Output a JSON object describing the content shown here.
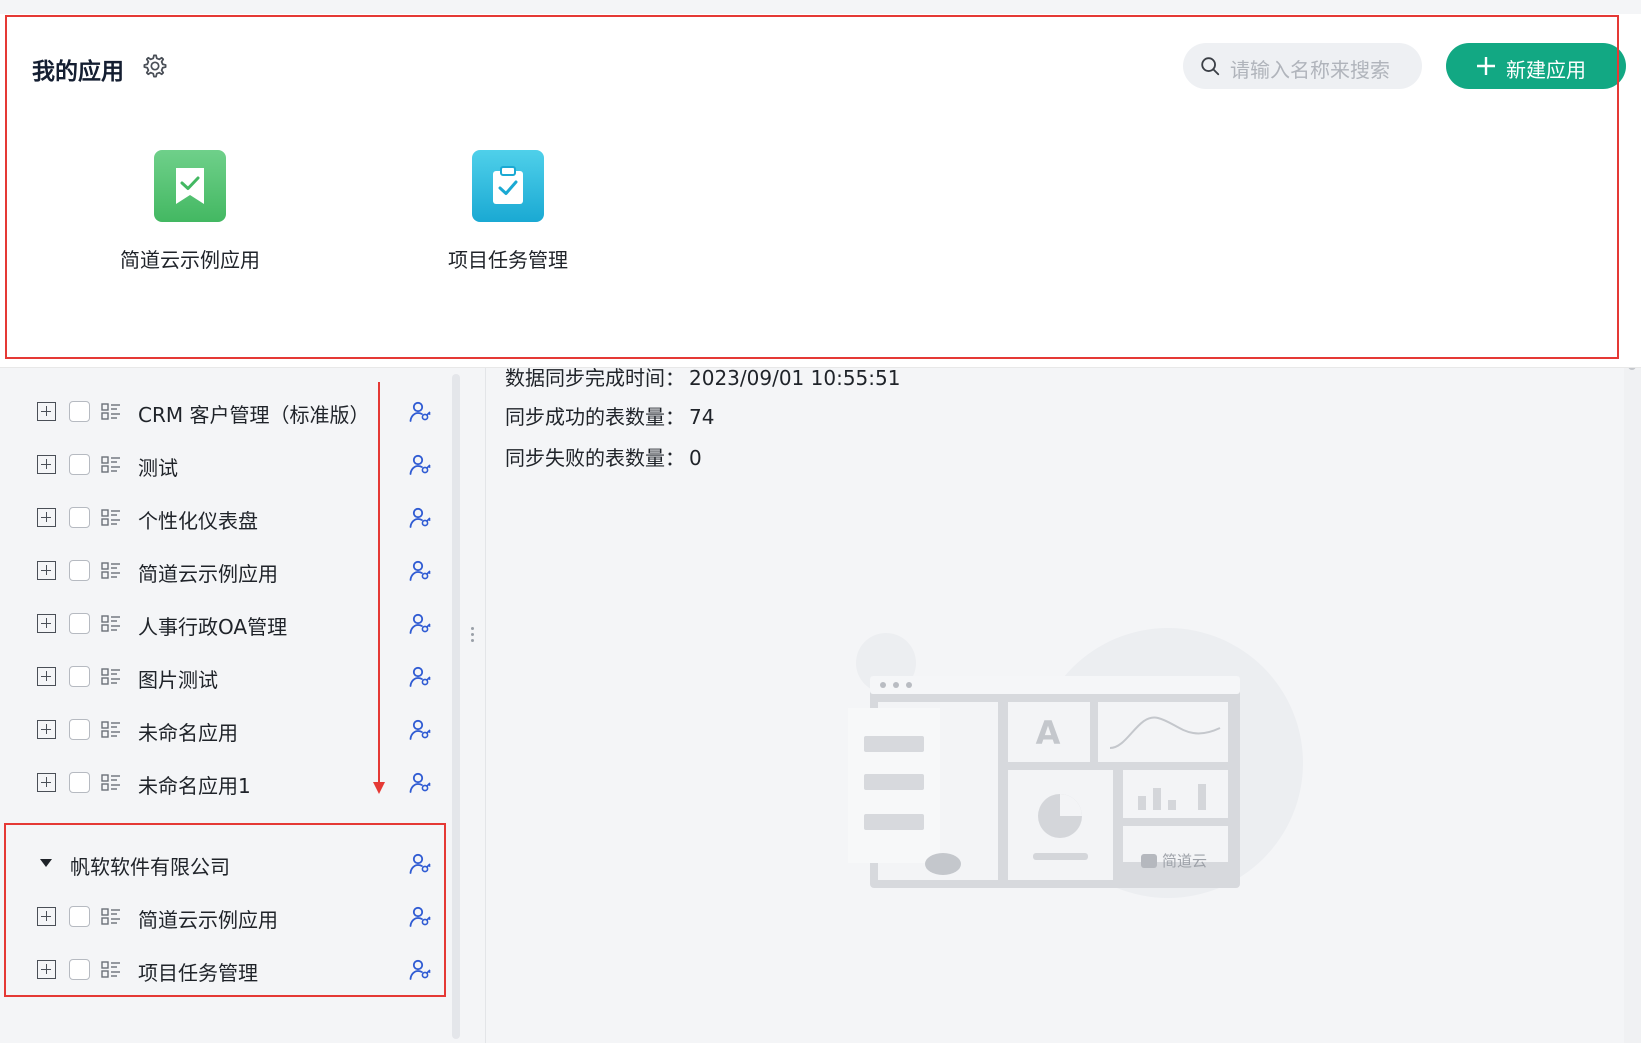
{
  "apps_panel": {
    "title": "我的应用",
    "search_placeholder": "请输入名称来搜索",
    "new_app_label": "新建应用",
    "apps": [
      {
        "name": "简道云示例应用",
        "icon": "bookmark-check-icon",
        "color": "#4cc26f"
      },
      {
        "name": "项目任务管理",
        "icon": "clipboard-check-icon",
        "color": "#29b8de"
      }
    ]
  },
  "tree": {
    "items": [
      {
        "label": "CRM 客户管理（标准版）"
      },
      {
        "label": "测试"
      },
      {
        "label": "个性化仪表盘"
      },
      {
        "label": "简道云示例应用"
      },
      {
        "label": "人事行政OA管理"
      },
      {
        "label": "图片测试"
      },
      {
        "label": "未命名应用"
      },
      {
        "label": "未命名应用1"
      }
    ],
    "group": {
      "label": "帆软软件有限公司",
      "items": [
        {
          "label": "简道云示例应用"
        },
        {
          "label": "项目任务管理"
        }
      ]
    }
  },
  "detail": {
    "sync_time_label": "数据同步完成时间：",
    "sync_time_value": "2023/09/01 10:55:51",
    "sync_success_label": "同步成功的表数量：",
    "sync_success_value": "74",
    "sync_fail_label": "同步失败的表数量：",
    "sync_fail_value": "0",
    "illustration_brand": "简道云"
  },
  "colors": {
    "accent": "#12a883",
    "annotation_red": "#e53935",
    "perm_icon_blue": "#2f5bd3"
  }
}
